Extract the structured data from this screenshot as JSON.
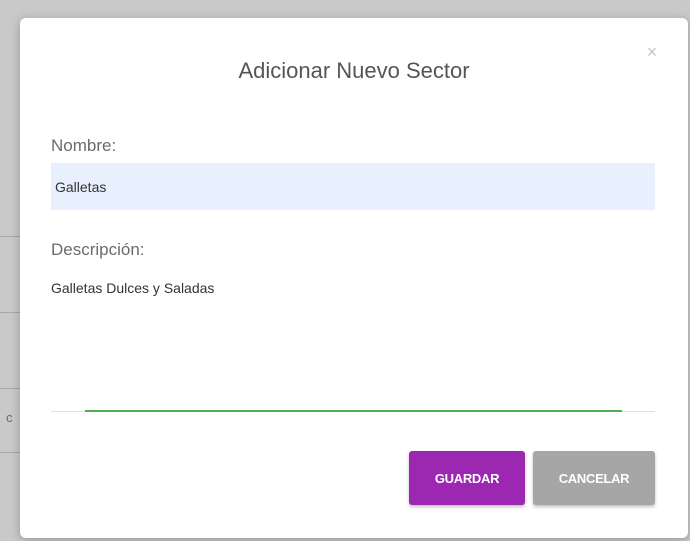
{
  "background": {
    "fragment_text": "c"
  },
  "dialog": {
    "title": "Adicionar Nuevo Sector",
    "close_symbol": "×",
    "name_label": "Nombre:",
    "name_value": "Galletas",
    "description_label": "Descripción:",
    "description_value": "Galletas Dulces y Saladas",
    "save_label": "GUARDAR",
    "cancel_label": "CANCELAR"
  },
  "colors": {
    "save_button": "#9c27b0",
    "cancel_button": "#a6a6a6",
    "active_underline": "#4caf50",
    "autofill_background": "#e8f0fe"
  },
  "icons": {
    "close": "close-icon"
  }
}
